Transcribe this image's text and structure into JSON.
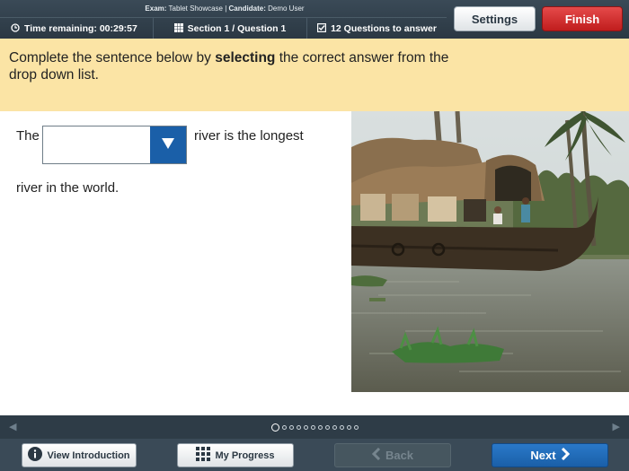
{
  "header": {
    "exam_label": "Exam:",
    "exam_value": "Tablet Showcase",
    "candidate_label": "Candidate:",
    "candidate_value": "Demo User",
    "time_remaining": "Time remaining: 00:29:57",
    "section": "Section 1 / Question 1",
    "questions_to_answer": "12 Questions to answer",
    "settings_label": "Settings",
    "finish_label": "Finish"
  },
  "instruction": {
    "prefix": "Complete the sentence below by ",
    "bold": "selecting",
    "suffix": " the correct answer from the drop down list."
  },
  "question": {
    "before": "The",
    "after": "river is the longest",
    "line2": "river in the world.",
    "dropdown_value": ""
  },
  "pager": {
    "total_pages": 12,
    "current_page": 1
  },
  "footer": {
    "intro_label": "View Introduction",
    "progress_label": "My Progress",
    "back_label": "Back",
    "next_label": "Next"
  },
  "colors": {
    "header_bg": "#2b3843",
    "instruction_bg": "#fbe4a5",
    "accent_blue": "#1a5fa8",
    "finish_red": "#c01d1d"
  }
}
